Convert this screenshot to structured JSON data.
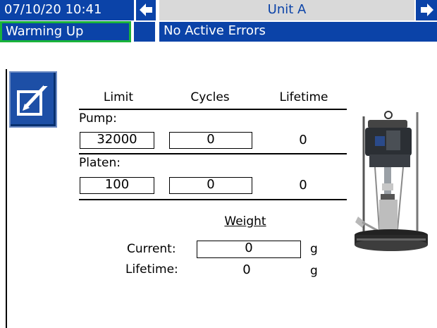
{
  "status_bar": {
    "datetime": "07/10/20 10:41",
    "unit_name": "Unit A",
    "state": "Warming Up",
    "errors": "No Active Errors"
  },
  "table": {
    "headers": {
      "limit": "Limit",
      "cycles": "Cycles",
      "lifetime": "Lifetime"
    },
    "rows": [
      {
        "name": "Pump:",
        "limit": "32000",
        "cycles": "0",
        "lifetime": "0"
      },
      {
        "name": "Platen:",
        "limit": "100",
        "cycles": "0",
        "lifetime": "0"
      }
    ]
  },
  "weight": {
    "title": "Weight",
    "current_label": "Current:",
    "current_value": "0",
    "current_unit": "g",
    "lifetime_label": "Lifetime:",
    "lifetime_value": "0",
    "lifetime_unit": "g"
  },
  "colors": {
    "header_blue": "#0b43a8",
    "status_green_border": "#19b33a",
    "background": "#ffffff"
  },
  "icons": {
    "edit": "edit-pencil-icon",
    "prev": "arrow-left-icon",
    "next": "arrow-right-icon",
    "equipment": "pump-platen-illustration"
  }
}
